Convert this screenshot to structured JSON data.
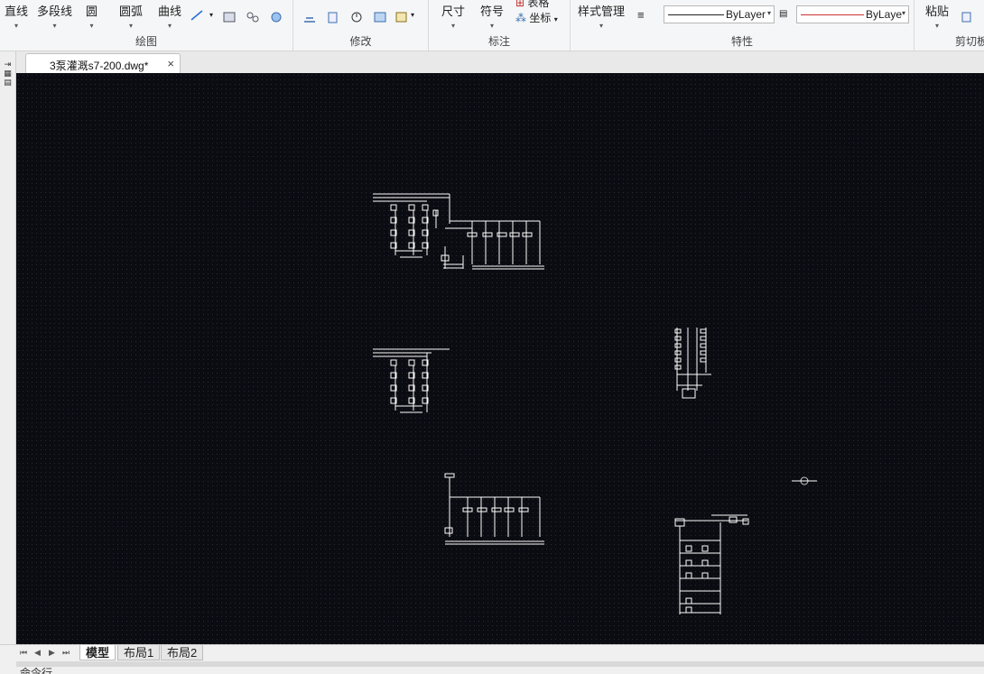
{
  "ribbon": {
    "draw": {
      "title": "绘图",
      "line_label": "直线",
      "polyline_label": "多段线",
      "circle_label": "圆",
      "arc_label": "圆弧",
      "curve_label": "曲线"
    },
    "modify": {
      "title": "修改"
    },
    "annotate": {
      "title": "标注",
      "dimension_label": "尺寸",
      "symbol_label": "符号",
      "table_label": "表格",
      "coordinate_label": "坐标"
    },
    "properties": {
      "title": "特性",
      "style_manager_label": "样式管理",
      "linetype_value": "ByLayer",
      "lineweight_value": "ByLayе"
    },
    "clipboard": {
      "title": "剪切板",
      "paste_label": "粘贴"
    }
  },
  "document": {
    "tab_title": "3泵灌溉s7-200.dwg*"
  },
  "layout_tabs": [
    "模型",
    "布局1",
    "布局2"
  ],
  "command_line": "命令行",
  "colors": {
    "canvas_bg": "#0b0b12",
    "drawing_stroke": "#ffffff",
    "lineweight_red": "#cc3333"
  }
}
